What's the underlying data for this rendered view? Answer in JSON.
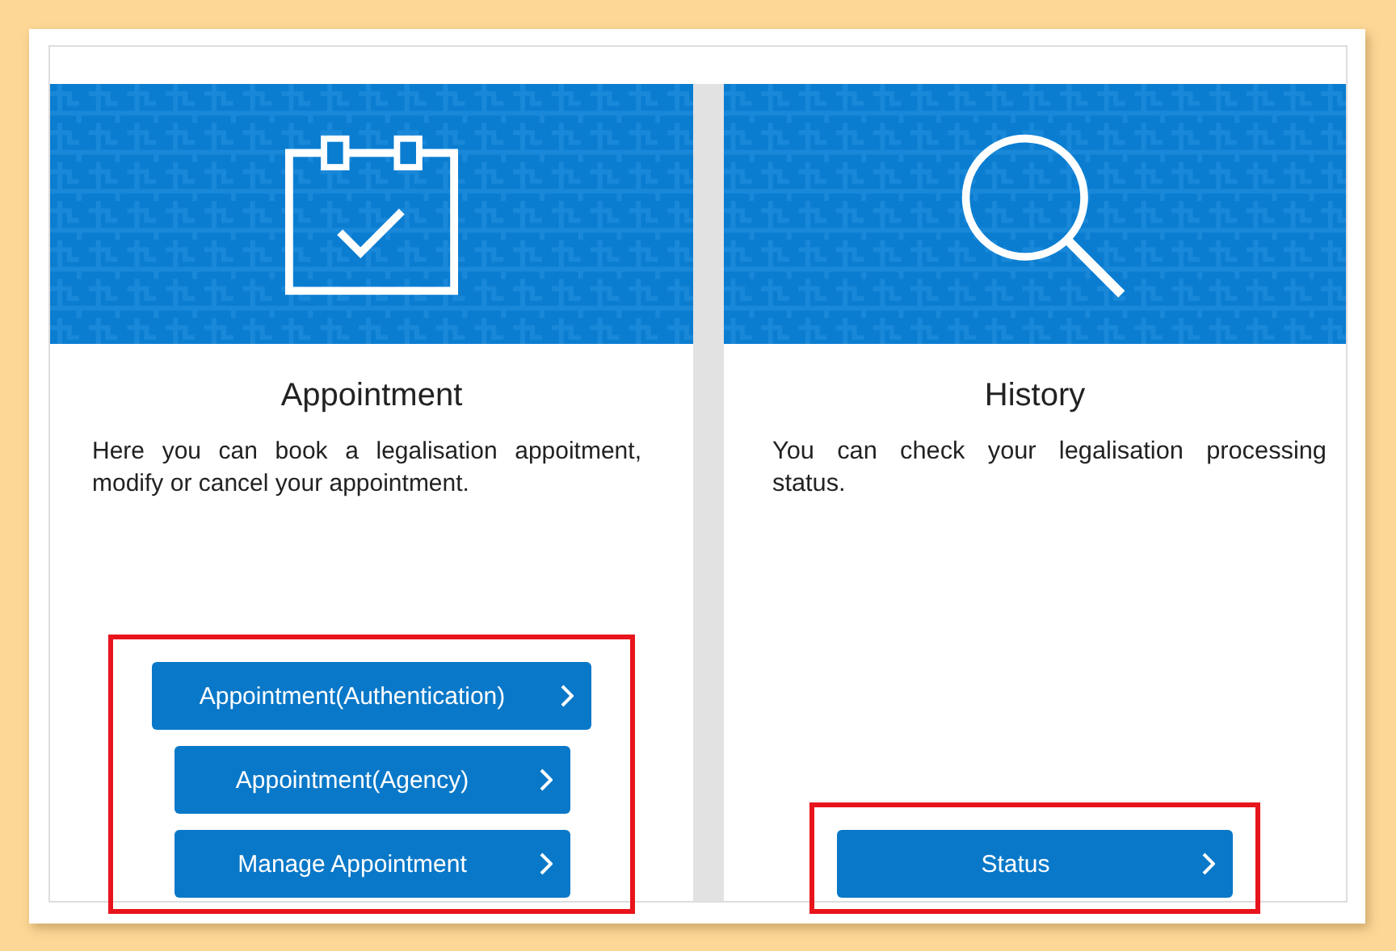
{
  "cards": [
    {
      "kind": "calendar",
      "title": "Appointment",
      "description": "Here you can book a legalisation appoitment, modify or cancel your appointment.",
      "buttons": [
        {
          "label": "Appointment(Authentication)",
          "kind": "wide"
        },
        {
          "label": "Appointment(Agency)",
          "kind": "normal"
        },
        {
          "label": "Manage Appointment",
          "kind": "normal"
        }
      ]
    },
    {
      "kind": "search",
      "title": "History",
      "description": "You can check your legalisation processing status.",
      "buttons": [
        {
          "label": "Status",
          "kind": "normal"
        }
      ]
    }
  ]
}
